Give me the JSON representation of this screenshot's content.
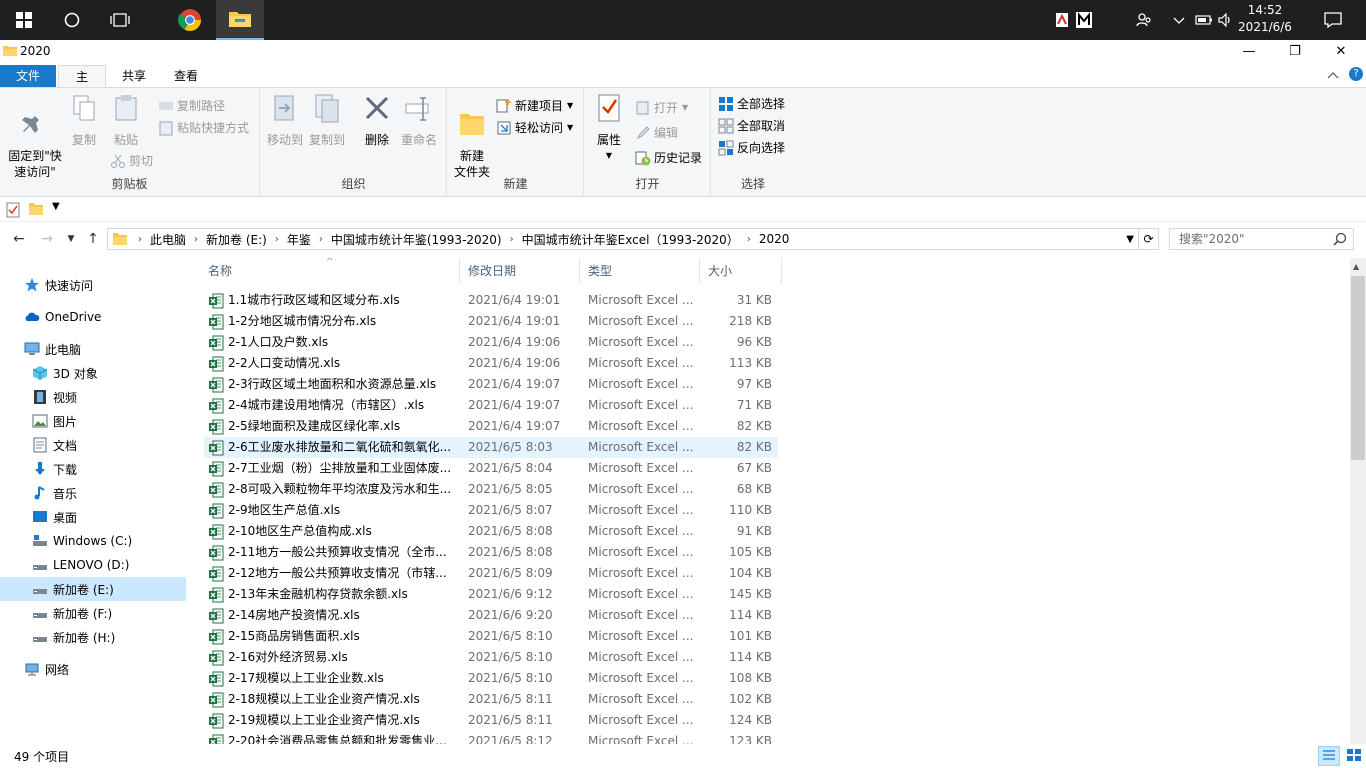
{
  "taskbar": {
    "clock_time": "14:52",
    "clock_date": "2021/6/6"
  },
  "window": {
    "title": "2020",
    "minimize_label": "—",
    "maximize_label": "❐",
    "close_label": "✕"
  },
  "ribbon_tabs": {
    "file": "文件",
    "home": "主页",
    "share": "共享",
    "view": "查看"
  },
  "ribbon": {
    "clipboard": {
      "label": "剪贴板",
      "pin": "固定到\"快\n速访问\"",
      "copy": "复制",
      "paste": "粘贴",
      "copy_path": "复制路径",
      "paste_shortcut": "粘贴快捷方式",
      "cut": "剪切"
    },
    "organize": {
      "label": "组织",
      "move_to": "移动到",
      "copy_to": "复制到",
      "delete": "删除",
      "rename": "重命名"
    },
    "new": {
      "label": "新建",
      "new_folder": "新建\n文件夹",
      "new_item": "新建项目",
      "easy_access": "轻松访问"
    },
    "open": {
      "label": "打开",
      "properties": "属性",
      "open": "打开",
      "edit": "编辑",
      "history": "历史记录"
    },
    "select": {
      "label": "选择",
      "select_all": "全部选择",
      "select_none": "全部取消",
      "invert": "反向选择"
    }
  },
  "address": {
    "crumbs": [
      "此电脑",
      "新加卷 (E:)",
      "年鉴",
      "中国城市统计年鉴(1993-2020)",
      "中国城市统计年鉴Excel（1993-2020）",
      "2020"
    ],
    "search_placeholder": "搜索\"2020\""
  },
  "navpane": {
    "quick_access": "快速访问",
    "onedrive": "OneDrive",
    "this_pc": "此电脑",
    "objects3d": "3D 对象",
    "videos": "视频",
    "pictures": "图片",
    "documents": "文档",
    "downloads": "下载",
    "music": "音乐",
    "desktop": "桌面",
    "drive_c": "Windows (C:)",
    "drive_d": "LENOVO (D:)",
    "drive_e": "新加卷 (E:)",
    "drive_f": "新加卷 (F:)",
    "drive_h": "新加卷 (H:)",
    "network": "网络"
  },
  "columns": {
    "name": "名称",
    "date": "修改日期",
    "type": "类型",
    "size": "大小"
  },
  "files": [
    {
      "name": "1.1城市行政区域和区域分布.xls",
      "date": "2021/6/4 19:01",
      "type": "Microsoft Excel ...",
      "size": "31 KB"
    },
    {
      "name": "1-2分地区城市情况分布.xls",
      "date": "2021/6/4 19:01",
      "type": "Microsoft Excel ...",
      "size": "218 KB"
    },
    {
      "name": "2-1人口及户数.xls",
      "date": "2021/6/4 19:06",
      "type": "Microsoft Excel ...",
      "size": "96 KB"
    },
    {
      "name": "2-2人口变动情况.xls",
      "date": "2021/6/4 19:06",
      "type": "Microsoft Excel ...",
      "size": "113 KB"
    },
    {
      "name": "2-3行政区域土地面积和水资源总量.xls",
      "date": "2021/6/4 19:07",
      "type": "Microsoft Excel ...",
      "size": "97 KB"
    },
    {
      "name": "2-4城市建设用地情况（市辖区）.xls",
      "date": "2021/6/4 19:07",
      "type": "Microsoft Excel ...",
      "size": "71 KB"
    },
    {
      "name": "2-5绿地面积及建成区绿化率.xls",
      "date": "2021/6/4 19:07",
      "type": "Microsoft Excel ...",
      "size": "82 KB"
    },
    {
      "name": "2-6工业废水排放量和二氧化硫和氨氧化...",
      "date": "2021/6/5 8:03",
      "type": "Microsoft Excel ...",
      "size": "82 KB"
    },
    {
      "name": "2-7工业烟（粉）尘排放量和工业固体废...",
      "date": "2021/6/5 8:04",
      "type": "Microsoft Excel ...",
      "size": "67 KB"
    },
    {
      "name": "2-8可吸入颗粒物年平均浓度及污水和生...",
      "date": "2021/6/5 8:05",
      "type": "Microsoft Excel ...",
      "size": "68 KB"
    },
    {
      "name": "2-9地区生产总值.xls",
      "date": "2021/6/5 8:07",
      "type": "Microsoft Excel ...",
      "size": "110 KB"
    },
    {
      "name": "2-10地区生产总值构成.xls",
      "date": "2021/6/5 8:08",
      "type": "Microsoft Excel ...",
      "size": "91 KB"
    },
    {
      "name": "2-11地方一般公共预算收支情况（全市...",
      "date": "2021/6/5 8:08",
      "type": "Microsoft Excel ...",
      "size": "105 KB"
    },
    {
      "name": "2-12地方一般公共预算收支情况（市辖...",
      "date": "2021/6/5 8:09",
      "type": "Microsoft Excel ...",
      "size": "104 KB"
    },
    {
      "name": "2-13年末金融机构存贷款余额.xls",
      "date": "2021/6/6 9:12",
      "type": "Microsoft Excel ...",
      "size": "145 KB"
    },
    {
      "name": "2-14房地产投资情况.xls",
      "date": "2021/6/6 9:20",
      "type": "Microsoft Excel ...",
      "size": "114 KB"
    },
    {
      "name": "2-15商品房销售面积.xls",
      "date": "2021/6/5 8:10",
      "type": "Microsoft Excel ...",
      "size": "101 KB"
    },
    {
      "name": "2-16对外经济贸易.xls",
      "date": "2021/6/5 8:10",
      "type": "Microsoft Excel ...",
      "size": "114 KB"
    },
    {
      "name": "2-17规模以上工业企业数.xls",
      "date": "2021/6/5 8:10",
      "type": "Microsoft Excel ...",
      "size": "108 KB"
    },
    {
      "name": "2-18规模以上工业企业资产情况.xls",
      "date": "2021/6/5 8:11",
      "type": "Microsoft Excel ...",
      "size": "102 KB"
    },
    {
      "name": "2-19规模以上工业企业资产情况.xls",
      "date": "2021/6/5 8:11",
      "type": "Microsoft Excel ...",
      "size": "124 KB"
    },
    {
      "name": "2-20社会消费品零售总额和批发零售业...",
      "date": "2021/6/5 8:12",
      "type": "Microsoft Excel ...",
      "size": "123 KB"
    }
  ],
  "hover_row_index": 7,
  "status": {
    "item_count": "49 个项目"
  },
  "colors": {
    "accent": "#1979ca",
    "selection": "#cce8ff",
    "hover": "#e5f3ff",
    "taskbar": "#1f1f1f",
    "excel_green": "#1e7145"
  }
}
